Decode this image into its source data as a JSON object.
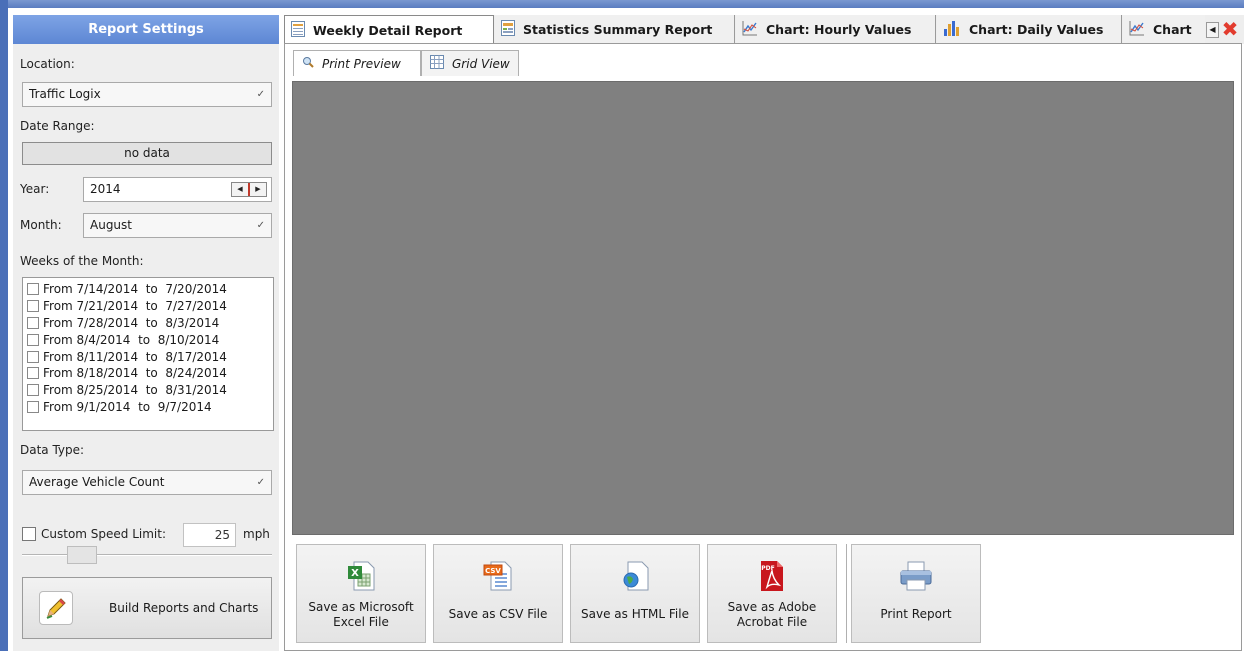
{
  "settings": {
    "header": "Report Settings",
    "location_label": "Location:",
    "location_value": "Traffic Logix",
    "date_range_label": "Date Range:",
    "date_range_value": "no data",
    "year_label": "Year:",
    "year_value": "2014",
    "month_label": "Month:",
    "month_value": "August",
    "weeks_label": "Weeks of the Month:",
    "weeks": [
      "From 7/14/2014  to  7/20/2014",
      "From 7/21/2014  to  7/27/2014",
      "From 7/28/2014  to  8/3/2014",
      "From 8/4/2014  to  8/10/2014",
      "From 8/11/2014  to  8/17/2014",
      "From 8/18/2014  to  8/24/2014",
      "From 8/25/2014  to  8/31/2014",
      "From 9/1/2014  to  9/7/2014"
    ],
    "data_type_label": "Data Type:",
    "data_type_value": "Average Vehicle Count",
    "speed_limit_label": "Custom Speed Limit:",
    "speed_limit_value": "25",
    "speed_unit": "mph",
    "build_button": "Build Reports and Charts"
  },
  "tabs": [
    {
      "label": "Weekly Detail Report",
      "icon": "table-icon",
      "active": true
    },
    {
      "label": "Statistics Summary Report",
      "icon": "summary-icon",
      "active": false
    },
    {
      "label": "Chart: Hourly Values",
      "icon": "line-chart-icon",
      "active": false
    },
    {
      "label": "Chart: Daily Values",
      "icon": "bar-chart-icon",
      "active": false
    },
    {
      "label": "Chart",
      "icon": "line-chart-icon",
      "active": false
    }
  ],
  "subtabs": [
    {
      "label": "Print Preview",
      "icon": "magnifier-icon",
      "active": true
    },
    {
      "label": "Grid View",
      "icon": "grid-icon",
      "active": false
    }
  ],
  "toolbar": {
    "excel": "Save as Microsoft Excel File",
    "csv": "Save as CSV File",
    "html": "Save as HTML File",
    "pdf": "Save as Adobe Acrobat File",
    "print": "Print Report"
  },
  "colors": {
    "header_blue": "#6b92db",
    "preview_gray": "#808080",
    "close_red": "#e23b2e"
  }
}
